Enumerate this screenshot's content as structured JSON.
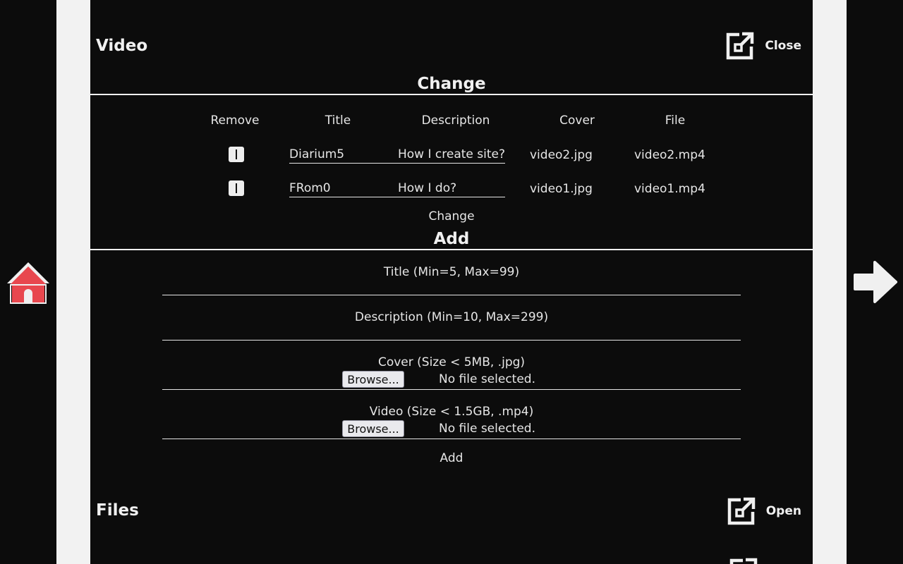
{
  "video": {
    "title": "Video",
    "close_label": "Close",
    "change_heading": "Change",
    "table": {
      "headers": [
        "Remove",
        "Title",
        "Description",
        "Cover",
        "File"
      ],
      "rows": [
        {
          "title": "Diarium5",
          "description": "How I create site?",
          "cover": "video2.jpg",
          "file": "video2.mp4"
        },
        {
          "title": "FRom0",
          "description": "How I do?",
          "cover": "video1.jpg",
          "file": "video1.mp4"
        }
      ]
    },
    "change_button": "Change",
    "add_heading": "Add",
    "form": {
      "title_label": "Title (Min=5, Max=99)",
      "description_label": "Description (Min=10, Max=299)",
      "cover_label": "Cover (Size < 5MB, .jpg)",
      "video_label": "Video (Size < 1.5GB, .mp4)",
      "browse_label": "Browse...",
      "no_file_text": "No file selected."
    },
    "add_button": "Add"
  },
  "files": {
    "title": "Files",
    "open_label": "Open"
  },
  "nav": {
    "home_icon": "home-icon",
    "next_icon": "arrow-right-icon",
    "home_color": "#e8474e"
  }
}
